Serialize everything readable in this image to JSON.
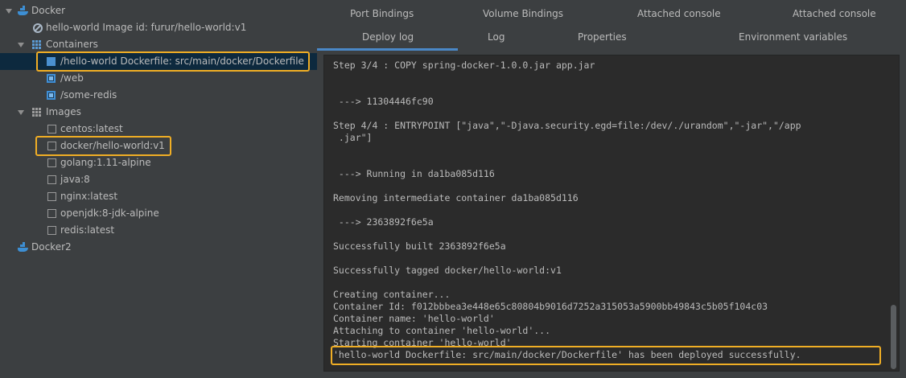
{
  "tree": {
    "items": [
      {
        "label": "Docker",
        "icon": "docker-icon"
      },
      {
        "label": "hello-world Image id: furur/hello-world:v1",
        "icon": "no-entry-icon"
      },
      {
        "label": "Containers",
        "icon": "containers-grid-icon"
      },
      {
        "label": "/hello-world Dockerfile: src/main/docker/Dockerfile",
        "icon": "container-icon"
      },
      {
        "label": "/web",
        "icon": "container-icon"
      },
      {
        "label": "/some-redis",
        "icon": "container-icon"
      },
      {
        "label": "Images",
        "icon": "images-grid-icon"
      },
      {
        "label": "centos:latest",
        "icon": "image-icon"
      },
      {
        "label": "docker/hello-world:v1",
        "icon": "image-icon"
      },
      {
        "label": "golang:1.11-alpine",
        "icon": "image-icon"
      },
      {
        "label": "java:8",
        "icon": "image-icon"
      },
      {
        "label": "nginx:latest",
        "icon": "image-icon"
      },
      {
        "label": "openjdk:8-jdk-alpine",
        "icon": "image-icon"
      },
      {
        "label": "redis:latest",
        "icon": "image-icon"
      },
      {
        "label": "Docker2",
        "icon": "docker-icon"
      }
    ]
  },
  "tabs": {
    "row1": [
      "Port Bindings",
      "Volume Bindings",
      "Attached console",
      "Attached console"
    ],
    "row2": [
      "Deploy log",
      "Log",
      "Properties",
      "Environment variables"
    ],
    "active": "Deploy log"
  },
  "console": {
    "lines": [
      "Step 3/4 : COPY spring-docker-1.0.0.jar app.jar",
      "",
      " ---> 11304446fc90",
      "",
      "Step 4/4 : ENTRYPOINT [\"java\",\"-Djava.security.egd=file:/dev/./urandom\",\"-jar\",\"/app",
      " .jar\"]",
      "",
      " ---> Running in da1ba085d116",
      "",
      "Removing intermediate container da1ba085d116",
      "",
      " ---> 2363892f6e5a",
      "",
      "Successfully built 2363892f6e5a",
      "",
      "Successfully tagged docker/hello-world:v1",
      "",
      "Creating container...",
      "Container Id: f012bbbea3e448e65c80804b9016d7252a315053a5900bb49843c5b05f104c03",
      "Container name: 'hello-world'",
      "Attaching to container 'hello-world'...",
      "Starting container 'hello-world'",
      "'hello-world Dockerfile: src/main/docker/Dockerfile' has been deployed successfully."
    ]
  },
  "colors": {
    "background": "#3c3f41",
    "console_background": "#2b2b2b",
    "selection": "#0d293e",
    "highlight": "#f0ae25",
    "accent": "#4a88c7",
    "docker_blue": "#3d8fd4"
  }
}
